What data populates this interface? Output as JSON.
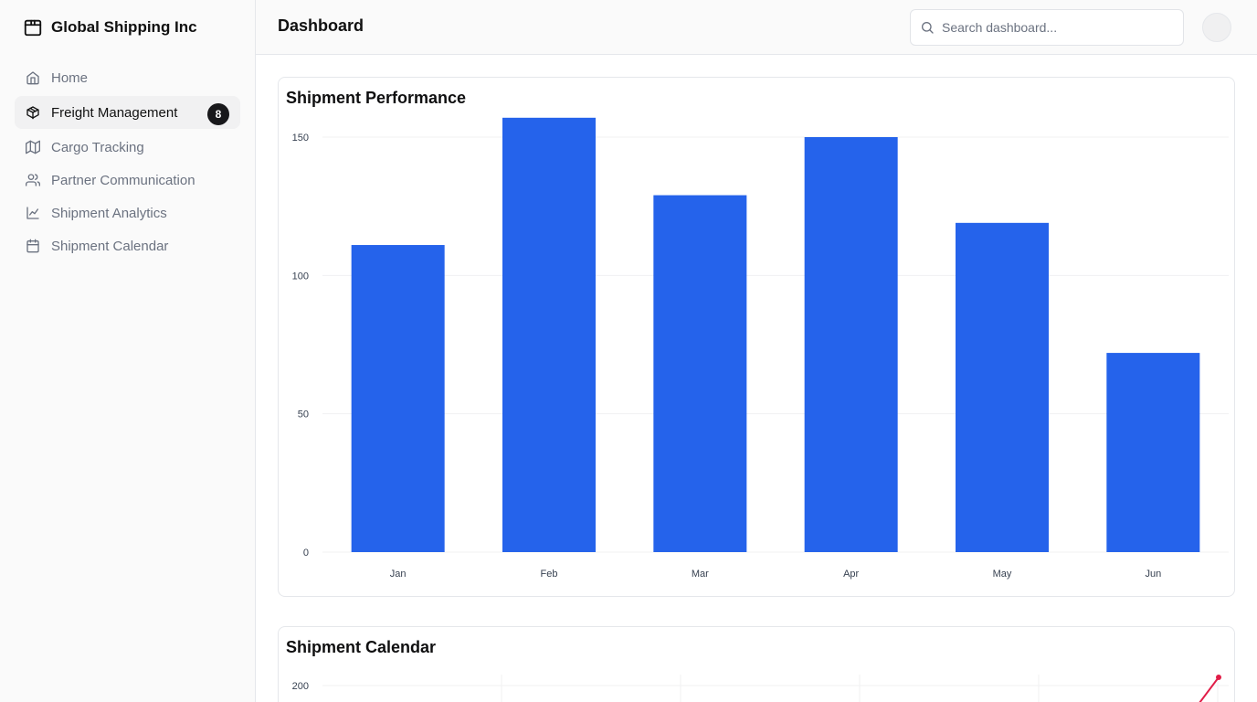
{
  "brand": {
    "name": "Global Shipping Inc",
    "icon": "package-icon"
  },
  "sidebar": {
    "items": [
      {
        "label": "Home",
        "icon": "home-icon",
        "active": false
      },
      {
        "label": "Freight Management",
        "icon": "box-icon",
        "active": true,
        "badge": "8"
      },
      {
        "label": "Cargo Tracking",
        "icon": "map-icon",
        "active": false
      },
      {
        "label": "Partner Communication",
        "icon": "users-icon",
        "active": false
      },
      {
        "label": "Shipment Analytics",
        "icon": "line-chart-icon",
        "active": false
      },
      {
        "label": "Shipment Calendar",
        "icon": "calendar-icon",
        "active": false
      }
    ]
  },
  "header": {
    "title": "Dashboard",
    "search": {
      "placeholder": "Search dashboard...",
      "value": ""
    }
  },
  "colors": {
    "bar": "#2563eb",
    "line": "#e11d48",
    "accent": "#18181b"
  },
  "chart_data": [
    {
      "type": "bar",
      "title": "Shipment Performance",
      "categories": [
        "Jan",
        "Feb",
        "Mar",
        "Apr",
        "May",
        "Jun"
      ],
      "values": [
        111,
        157,
        129,
        150,
        119,
        72
      ],
      "yticks": [
        0,
        50,
        100,
        150
      ],
      "ylim": [
        0,
        150
      ],
      "grid": true
    },
    {
      "type": "line",
      "title": "Shipment Calendar",
      "yticks": [
        200
      ],
      "grid": true
    }
  ]
}
